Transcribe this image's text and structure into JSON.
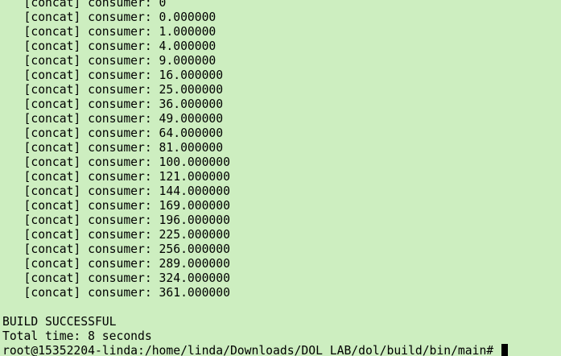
{
  "terminal": {
    "top_partial_line": "   [concat] consumer: 0",
    "output_lines": [
      "   [concat] consumer: 0.000000",
      "   [concat] consumer: 1.000000",
      "   [concat] consumer: 4.000000",
      "   [concat] consumer: 9.000000",
      "   [concat] consumer: 16.000000",
      "   [concat] consumer: 25.000000",
      "   [concat] consumer: 36.000000",
      "   [concat] consumer: 49.000000",
      "   [concat] consumer: 64.000000",
      "   [concat] consumer: 81.000000",
      "   [concat] consumer: 100.000000",
      "   [concat] consumer: 121.000000",
      "   [concat] consumer: 144.000000",
      "   [concat] consumer: 169.000000",
      "   [concat] consumer: 196.000000",
      "   [concat] consumer: 225.000000",
      "   [concat] consumer: 256.000000",
      "   [concat] consumer: 289.000000",
      "   [concat] consumer: 324.000000",
      "   [concat] consumer: 361.000000"
    ],
    "blank_line": "",
    "build_status": "BUILD SUCCESSFUL",
    "total_time": "Total time: 8 seconds",
    "prompt": "root@15352204-linda:/home/linda/Downloads/DOL_LAB/dol/build/bin/main# "
  },
  "colors": {
    "background": "#cdeec0",
    "foreground": "#000000"
  }
}
